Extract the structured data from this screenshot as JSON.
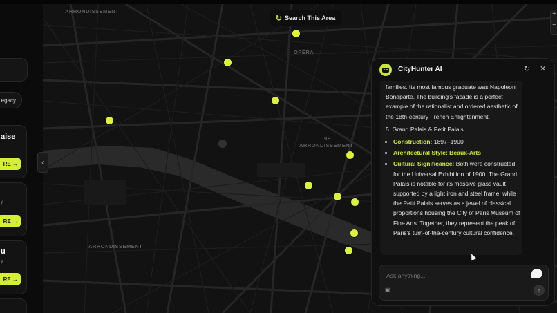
{
  "sidebar": {
    "pill_label": "Legacy",
    "cards": [
      {
        "title": "aise",
        "subtitle": "",
        "button": "RE →"
      },
      {
        "title": "",
        "subtitle": "y",
        "button": "RE →"
      },
      {
        "title": "u",
        "subtitle": "y",
        "button": "RE →"
      }
    ]
  },
  "map": {
    "search_button": "Search This Area",
    "labels": {
      "arr_top": "ARRONDISSEMENT",
      "opera": "OPÉRA",
      "arr_9e": "9E",
      "arr_9e_word": "ARRONDISSEMENT",
      "arr_bottom": "ARRONDISSEMENT"
    },
    "zoom_in": "+",
    "zoom_out": "−",
    "collapse_icon": "chevron-left-icon",
    "accent": "#dcf23b"
  },
  "chat": {
    "title": "CityHunter AI",
    "refresh_icon": "refresh-icon",
    "close_icon": "close-icon",
    "intro_text": "families. Its most famous graduate was Napoleon Bonaparte. The building's facade is a perfect example of the rationalist and ordered aesthetic of the 18th-century French Enlightenment.",
    "section_heading": "5. Grand Palais & Petit Palais",
    "bullets": [
      {
        "label": "Construction:",
        "text": " 1897–1900"
      },
      {
        "label": "Architectural Style: Beaux-Arts",
        "text": ""
      },
      {
        "label": "Cultural Significance:",
        "text": " Both were constructed for the Universal Exhibition of 1900. The Grand Palais is notable for its massive glass vault supported by a light iron and steel frame, while the Petit Palais serves as a jewel of classical proportions housing the City of Paris Museum of Fine Arts. Together, they represent the peak of Paris's turn-of-the-century cultural confidence."
      }
    ],
    "input_placeholder": "Ask anything...",
    "image_icon": "image-icon",
    "send_icon": "send-arrow-icon"
  }
}
